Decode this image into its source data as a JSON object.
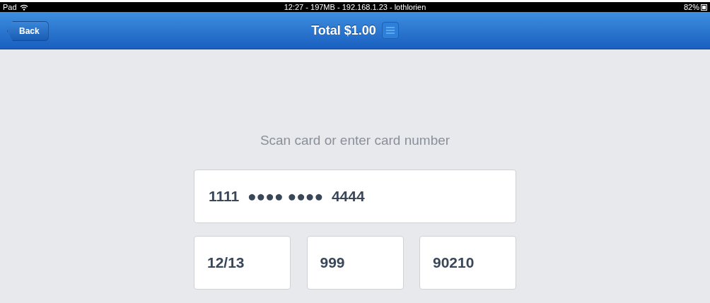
{
  "status_bar": {
    "device": "Pad",
    "center": "12:27 - 197MB - 192.168.1.23 - lothlorien",
    "battery": "82%"
  },
  "nav_bar": {
    "back": "Back",
    "title": "Total $1.00"
  },
  "prompt": "Scan card or enter card number",
  "card_number": "1111  ●●●● ●●●●  4444",
  "fields": [
    {
      "value": "12/13"
    },
    {
      "value": "999"
    },
    {
      "value": "90210"
    }
  ]
}
